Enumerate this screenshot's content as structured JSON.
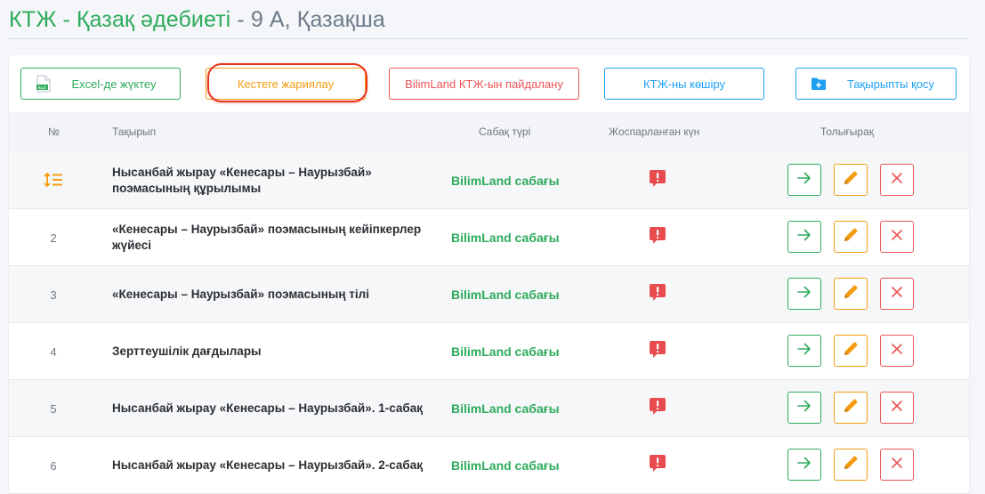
{
  "header": {
    "subject": "КТЖ - Қазақ әдебиеті",
    "separator": " - ",
    "class_lang": "9 А, Қазақша"
  },
  "toolbar": {
    "excel_label": "Excel-де жүктеу",
    "publish_label": "Кестеге жариялау",
    "bilimland_label": "BilimLand КТЖ-ын пайдалану",
    "copy_label": "КТЖ-ны көшіру",
    "add_topic_label": "Тақырыпты қосу"
  },
  "table": {
    "columns": {
      "num": "№",
      "topic": "Тақырып",
      "type": "Сабақ түрі",
      "date": "Жоспарланған күн",
      "more": "Толығырақ"
    },
    "rows": [
      {
        "num": "",
        "topic": "Нысанбай жырау «Кенесары – Наурызбай» поэмасының құрылымы",
        "type": "BilimLand сабағы",
        "date_icon": "alert-icon"
      },
      {
        "num": "2",
        "topic": "«Кенесары – Наурызбай» поэмасының кейіпкерлер жүйесі",
        "type": "BilimLand сабағы",
        "date_icon": "alert-icon"
      },
      {
        "num": "3",
        "topic": "«Кенесары – Наурызбай» поэмасының тілі",
        "type": "BilimLand сабағы",
        "date_icon": "alert-icon"
      },
      {
        "num": "4",
        "topic": "Зерттеушілік дағдылары",
        "type": "BilimLand сабағы",
        "date_icon": "alert-icon"
      },
      {
        "num": "5",
        "topic": "Нысанбай жырау «Кенесары – Наурызбай». 1-сабақ",
        "type": "BilimLand сабағы",
        "date_icon": "alert-icon"
      },
      {
        "num": "6",
        "topic": "Нысанбай жырау «Кенесары – Наурызбай». 2-сабақ",
        "type": "BilimLand сабағы",
        "date_icon": "alert-icon"
      }
    ]
  },
  "colors": {
    "green": "#2eab5c",
    "orange": "#f39c12",
    "red": "#ea5455",
    "blue": "#1e9ff2",
    "alert_red": "#e84c4f",
    "annotation_ring": "#e8351f"
  }
}
